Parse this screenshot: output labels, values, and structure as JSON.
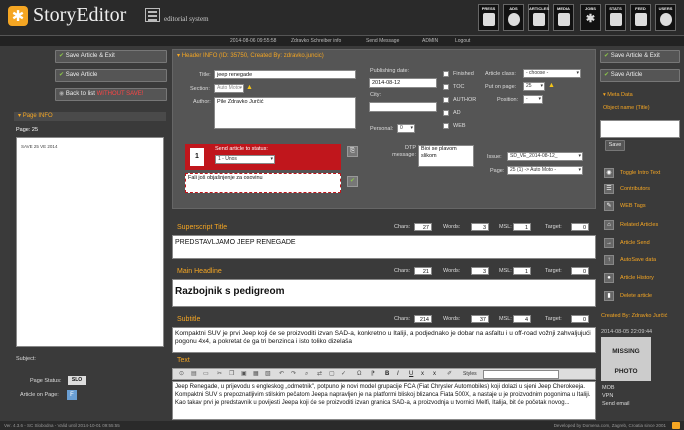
{
  "app": {
    "title": "StoryEditor",
    "subtitle": "editorial system"
  },
  "toolbar": [
    {
      "label": "PRESS",
      "icon": "press-icon"
    },
    {
      "label": "ADS",
      "icon": "ads-icon"
    },
    {
      "label": "ARTICLES",
      "icon": "articles-icon"
    },
    {
      "label": "MEDIA",
      "icon": "media-icon"
    },
    {
      "label": "JOBS",
      "icon": "jobs-icon"
    },
    {
      "label": "STATS",
      "icon": "stats-icon"
    },
    {
      "label": "FEED",
      "icon": "feed-icon"
    },
    {
      "label": "USERS",
      "icon": "users-icon"
    }
  ],
  "subnav": {
    "datetime": "2014-08-06 09:55:58",
    "user": "Zdravko Schreiber info",
    "send": "Send Message",
    "admin": "ADMIN",
    "logout": "Logout"
  },
  "left": {
    "save_exit": "Save Article & Exit",
    "save_exit_pre": "Save Article",
    "save_exit_post": "& Exit",
    "save": "Save Article",
    "back_pre": "Back to list",
    "back_post": "WITHOUT SAVE!",
    "page_info": "Page INFO",
    "page": "Page: 25",
    "thumb": "SAVE 25 VE 2014",
    "subject": "Subject:",
    "page_status_label": "Page Status:",
    "page_status": "SLO",
    "article_on_page_label": "Article on Page:",
    "article_on_page": "F"
  },
  "header_info": {
    "title": "Header INFO (ID: 35750, Created By: zdravko.juncic)",
    "title_label": "Title:",
    "title_value": "jeep renegade",
    "section_label": "Section:",
    "section_value": "Auto Moto",
    "author_label": "Author:",
    "author_value": "Pile Zdravko Jurčić",
    "pub_date_label": "Publishing date:",
    "pub_date_value": "2014-08-12",
    "city_label": "City:",
    "city_value": "",
    "personal_label": "Personal:",
    "personal_value": "0",
    "checks": [
      "Finished",
      "TOC",
      "AUTHOR",
      "AD",
      "WEB"
    ],
    "article_class_label": "Article class:",
    "article_class_value": "- choose -",
    "put_on_page_label": "Put on page:",
    "put_on_page_value": "25",
    "position_label": "Position:",
    "position_value": "-",
    "send_status_label": "Send article to status:",
    "send_status_num": "1",
    "send_status_value": "1 - Unos",
    "status_note": "Fali još objašnjenje za osovinu",
    "dtp_label": "DTP message:",
    "dtp_value": "Bioi se plavom slikom",
    "issue_label": "Issue:",
    "issue_value": "SD_VE_2014-08-12_",
    "page_label": "Page:",
    "page_value": "25 (1) -> Auto Moto -"
  },
  "superscript": {
    "label": "Superscript Title",
    "chars": "27",
    "words": "3",
    "msl": "1",
    "target": "0",
    "value": "PREDSTAVLJAMO JEEP RENEGADE"
  },
  "headline": {
    "label": "Main Headline",
    "chars": "21",
    "words": "3",
    "msl": "1",
    "target": "0",
    "value": "Razbojnik s pedigreom"
  },
  "subtitle": {
    "label": "Subtitle",
    "chars": "214",
    "words": "37",
    "msl": "4",
    "target": "0",
    "value": "Kompaktni SUV je prvi Jeep koji će se proizvoditi izvan SAD-a, konkretno u Italiji, a podjednako je dobar na asfaltu i u off-road vožnji zahvaljujući pogonu 4x4, a pokretat će ga tri benzinca i isto toliko dizelaša"
  },
  "text": {
    "label": "Text",
    "styles": "Styles",
    "value": "Jeep Renegade, u prijevodu s engleskog „odmetnik\", potpuno je novi model grupacije FCA (Fiat Chrysler Automobiles) koji dolazi u sjeni Jeep Cherokeeja. Kompaktni SUV s prepoznatljivim stilskim pečatom Jeepa napravljen je na platformi bliskoj blizanca Fiata 500X, a nastaje u je proizvodnim pogonima u Italiji. Kao takav prvi je predstavnik u povijesti Jeepa koji će se proizvoditi izvan granica SAD-a, a proizvodnja u tvornici Melfi, Italija, bit će početak novog..."
  },
  "counters": {
    "chars": "Chars:",
    "words": "Words:",
    "msl": "MSL:",
    "target": "Target:"
  },
  "right": {
    "save_exit_pre": "Save Article",
    "save_exit_post": "& Exit",
    "save": "Save Article",
    "meta": "Meta Data",
    "object_name": "Object name (Title)",
    "save_btn": "Save",
    "links": [
      "Toggle Intro Text",
      "Contributors",
      "WEB Tags",
      "Related Articles",
      "Article Send",
      "AutoSave data",
      "Article History",
      "Delete article"
    ],
    "created": "Created By: Zdravko Jurčić",
    "created_date": "2014-08-05 22:09:44",
    "missing1": "MISSING",
    "missing2": "PHOTO",
    "mob": "MOB",
    "vpn": "VPN",
    "send_email": "Send email"
  },
  "footer": {
    "left": "Ver. 4.3.6 - SC Slobodna - Valid until 2014-10-01 09:55:55",
    "right": "Developed by Domena.com, Zagreb, Croatia since 2001"
  }
}
